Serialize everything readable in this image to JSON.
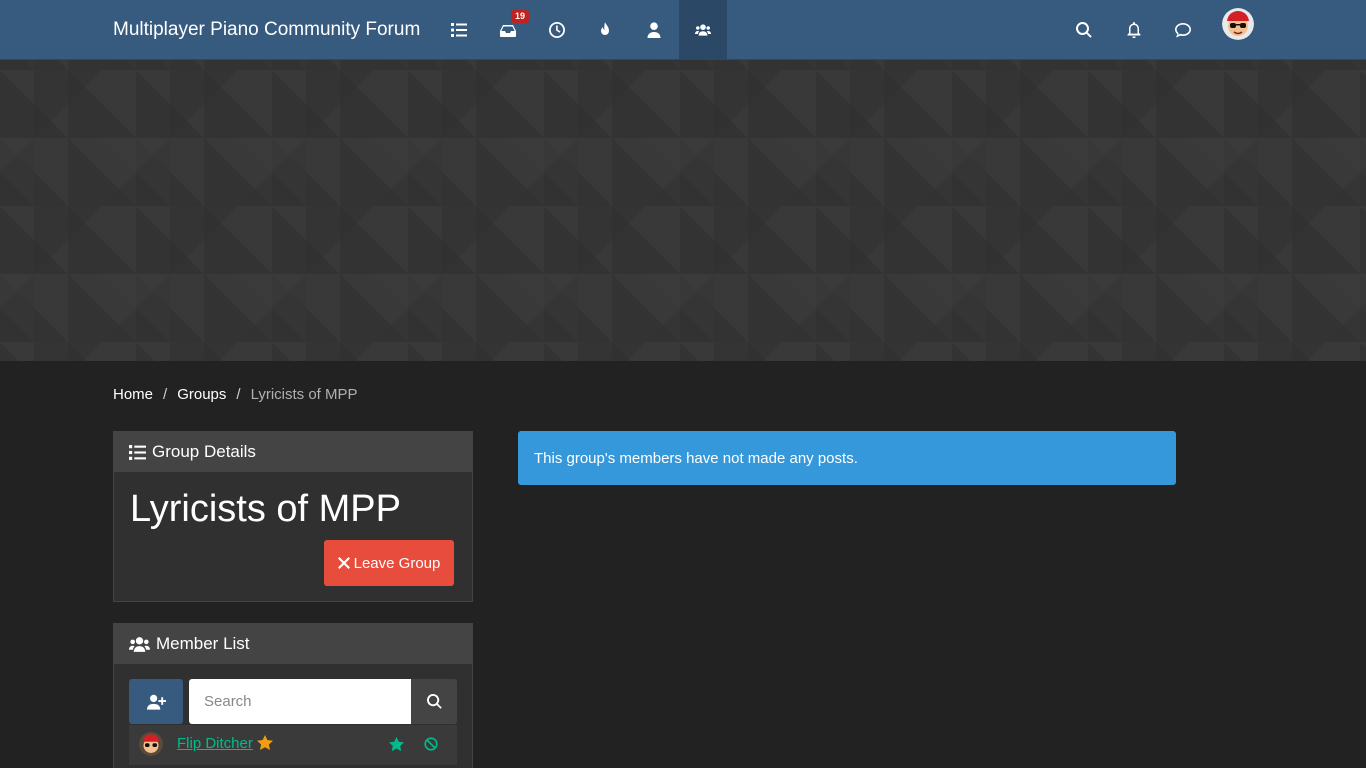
{
  "navbar": {
    "brand": "Multiplayer Piano Community Forum",
    "items": [
      {
        "name": "categories",
        "icon": "list-icon"
      },
      {
        "name": "unread",
        "icon": "inbox-icon",
        "badge": "19"
      },
      {
        "name": "recent",
        "icon": "clock-icon"
      },
      {
        "name": "popular",
        "icon": "fire-icon"
      },
      {
        "name": "users",
        "icon": "user-icon"
      },
      {
        "name": "groups",
        "icon": "users-icon",
        "active": true
      }
    ],
    "right": [
      {
        "name": "search",
        "icon": "search-icon"
      },
      {
        "name": "notifications",
        "icon": "bell-icon"
      },
      {
        "name": "chats",
        "icon": "comment-icon"
      }
    ]
  },
  "breadcrumb": {
    "items": [
      "Home",
      "Groups",
      "Lyricists of MPP"
    ],
    "separator": "/"
  },
  "group_details": {
    "header": "Group Details",
    "title": "Lyricists of MPP",
    "leave_label": "Leave Group"
  },
  "member_list": {
    "header": "Member List",
    "search_placeholder": "Search",
    "members": [
      {
        "name": "Flip Ditcher",
        "owner": true
      }
    ]
  },
  "alert": {
    "text": "This group's members have not made any posts."
  },
  "colors": {
    "navbar": "#375a7f",
    "success": "#00bc8c",
    "danger": "#e74c3c",
    "info": "#3498db",
    "warning": "#f39c12"
  }
}
